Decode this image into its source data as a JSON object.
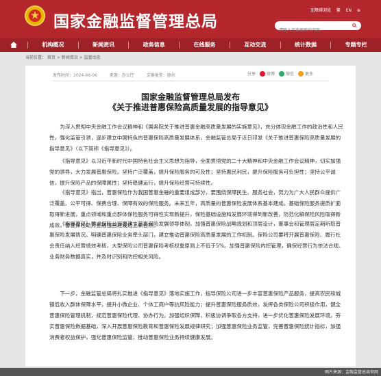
{
  "header": {
    "title": "国家金融监督管理总局",
    "util_links": [
      "无障碍浏览",
      "繁",
      "EN"
    ],
    "search_placeholder": "请输入您要搜索的内容"
  },
  "nav": {
    "home_icon": "home-icon",
    "items": [
      "机构概况",
      "新闻资讯",
      "政务信息",
      "在线服务",
      "互动交流",
      "统计数据",
      "专题专栏"
    ]
  },
  "breadcrumb": "当前位置： 首页 > 新闻资讯 > 监管动态",
  "article": {
    "meta": {
      "date": "发布时间：2024-06-06",
      "source": "来源：办公厅",
      "type": "文章类型：原创"
    },
    "share": [
      "分享",
      "微博",
      "微信",
      "更多"
    ],
    "title_line1": "国家金融监督管理总局发布",
    "title_line2": "《关于推进普惠保险高质量发展的指导意见》",
    "paragraphs": [
      "为深入贯彻中央金融工作会议精神和《国务院关于推进普惠金融高质量发展的实施意见》，充分体现金融工作的政治性和人民性，强化监管引领，逐步建立中国特色的普惠保险高质量发展体系，金融监管总局于近日印发《关于推进普惠保险高质量发展的指导意见》（以下简称《指导意见》）。",
      "《指导意见》以习近平新时代中国特色社会主义思想为指导，全面贯彻党的二十大精神和中央金融工作会议精神，切实加强党的领导，大力发展普惠保险。坚持广泛覆盖，提升保险服务的可及性；坚持惠民利民，提升保险服务可负担性；坚持公平诚信，提升保险产品的保障属性；坚持稳健运行，提升保险经营可持续性。",
      "《指导意见》指出，普惠保险作为我国普惠金融的重要组成部分，要围绕保障民生、服务社会，努力为广大人民群众提供广泛覆盖、公平可得、保费合理、保障有效的保险服务。未来五年，高质量的普惠保险发展体系基本建成。基础保险服务提质扩面取得新进展，重点领域和重点群体保险服务可得性实现新提升，保险基础设施和发展环境得到新改善，防范化解保险风险取得新成效，普惠保险助力金融强国建设迈上新台阶。",
      "《指导意见》要求保险公司要建立普惠保险发展领导体制，加强普惠保险战略规划和顶层设计，董事会和管理层定期听取普惠保险发展情况。明确普惠保险业务牵头部门，建立推动普惠保险高质量发展的工作机制。保险公司要将开展普惠保险、履行社会责任纳入经营绩效考核，大型保险公司普惠保险考核权重原则上不低于5%。加强普惠保险内控管理，确保经营行为依法合规、业务财务数据真实，并及时识别和防控相关风险。",
      "下一步，金融监管总局将扎实推进《指导意见》落地实施工作，指导保险公司进一步丰富普惠保险产品服务，提高农民和城镇低收入群体保障水平，提升小微企业、个体工商户等抗风险能力；提升普惠保险服务质效，发挥各类保险公司积极作用，健全普惠保险管理机制，规范普惠保险代理、协办行为。加强组织保障，积极协调争取各方支持，进一步优化普惠保险发展环境，夯实普惠保险数据基础，深入开展普惠保险教育和普惠保险发展规律研究；加强普惠保险业务监管，完善普惠保险统计指标，加强消费者权益保护，强化普惠保险监管，推动普惠保险业务持续健康发展。"
    ]
  },
  "image_credit": "图片来源：金融监管总局官网",
  "colors": {
    "brand_red": "#b4282d",
    "nav_red": "#9e2127",
    "emblem_gold": "#e8b400"
  }
}
